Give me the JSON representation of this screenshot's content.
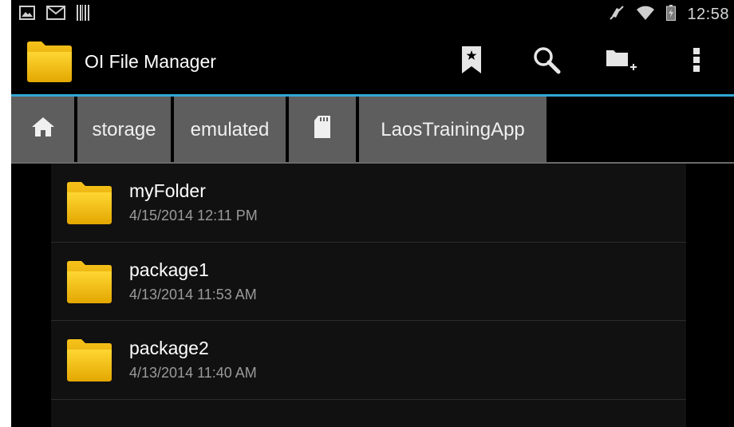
{
  "status_bar": {
    "time": "12:58",
    "icons": [
      "picture-notification-icon",
      "gmail-icon",
      "barcode-icon",
      "mute-icon",
      "wifi-icon",
      "battery-icon"
    ]
  },
  "action_bar": {
    "title": "OI File Manager",
    "actions": [
      "bookmark-icon",
      "search-icon",
      "new-folder-icon",
      "overflow-menu-icon"
    ],
    "accent_color": "#33a7d6"
  },
  "breadcrumb": {
    "items": [
      {
        "type": "icon",
        "icon": "home-icon"
      },
      {
        "type": "text",
        "label": "storage"
      },
      {
        "type": "text",
        "label": "emulated"
      },
      {
        "type": "icon",
        "icon": "sd-card-icon"
      },
      {
        "type": "text",
        "label": "LaosTrainingApp"
      }
    ]
  },
  "files": [
    {
      "name": "myFolder",
      "date": "4/15/2014 12:11 PM",
      "icon": "folder-icon"
    },
    {
      "name": "package1",
      "date": "4/13/2014 11:53 AM",
      "icon": "folder-icon"
    },
    {
      "name": "package2",
      "date": "4/13/2014 11:40 AM",
      "icon": "folder-icon"
    }
  ]
}
